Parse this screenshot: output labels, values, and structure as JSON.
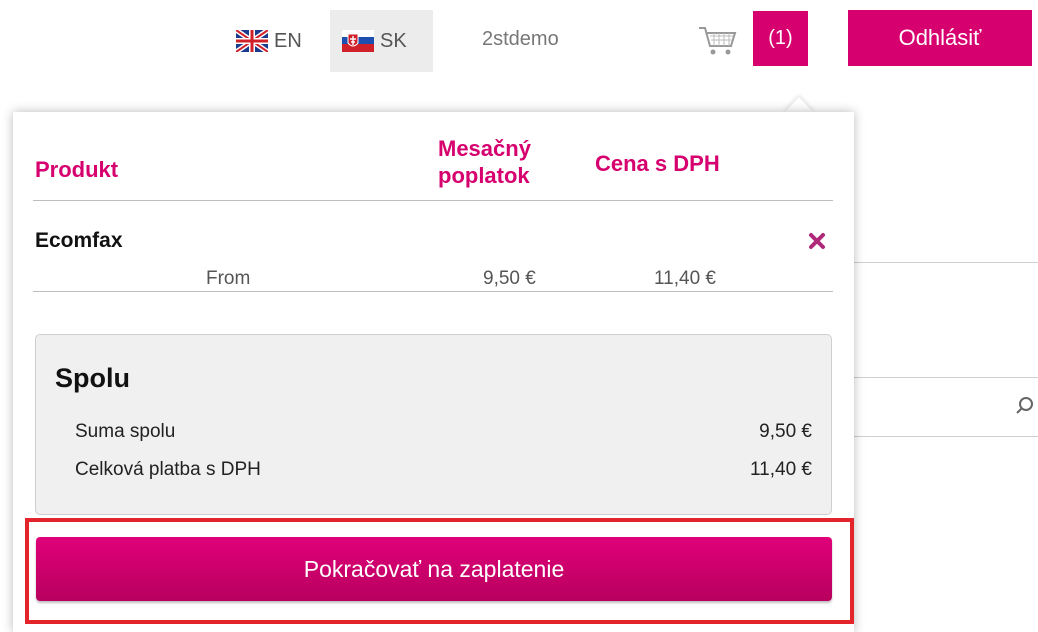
{
  "header": {
    "languages": [
      {
        "code": "EN",
        "flag": "uk-flag-icon"
      },
      {
        "code": "SK",
        "flag": "slovakia-flag-icon",
        "active": true
      }
    ],
    "username": "2stdemo",
    "cart_count": "(1)",
    "logout_label": "Odhlásiť"
  },
  "cart": {
    "columns": {
      "product": "Produkt",
      "monthly_fee": "Mesačný poplatok",
      "price_vat": "Cena s DPH"
    },
    "items": [
      {
        "name": "Ecomfax",
        "label": "From",
        "monthly": "9,50 €",
        "price": "11,40 €"
      }
    ],
    "summary": {
      "title": "Spolu",
      "total_label": "Suma spolu",
      "total_value": "9,50 €",
      "vat_total_label": "Celková platba s DPH",
      "vat_total_value": "11,40 €"
    },
    "checkout_label": "Pokračovať na zaplatenie"
  },
  "colors": {
    "accent": "#d6006e",
    "highlight": "#e3242b"
  }
}
